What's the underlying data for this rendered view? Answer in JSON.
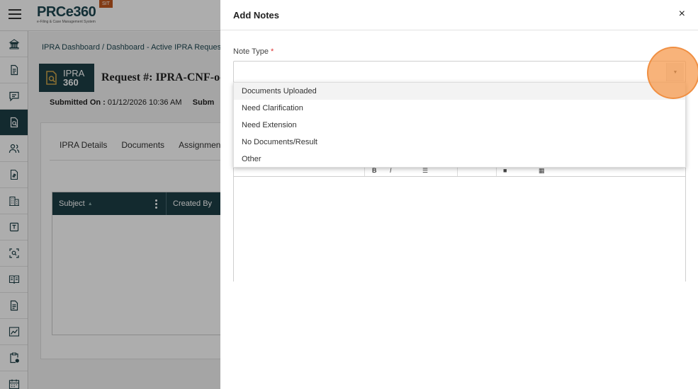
{
  "app": {
    "logo_text": "PRCe360",
    "logo_subtitle": "e-Filing & Case Management System",
    "env_badge": "SIT"
  },
  "breadcrumb": "IPRA Dashboard / Dashboard - Active IPRA Reques",
  "request": {
    "logo_line1": "IPRA",
    "logo_line2": "360",
    "title": "Request #: IPRA-CNF-oc",
    "submitted_label": "Submitted On :",
    "submitted_value": "01/12/2026 10:36 AM",
    "submitted_extra": "Subm"
  },
  "tabs": [
    "IPRA Details",
    "Documents",
    "Assignmen"
  ],
  "grid": {
    "columns": [
      "Subject",
      "Created By"
    ]
  },
  "sidebar_icons": [
    "bank-icon",
    "document-icon",
    "chat-icon",
    "document-search-icon",
    "users-icon",
    "invoice-icon",
    "building-icon",
    "template-icon",
    "scan-icon",
    "book-icon",
    "file-icon",
    "chart-icon",
    "clipboard-icon",
    "calendar-icon"
  ],
  "drawer": {
    "title": "Add Notes",
    "close": "×",
    "note_type_label": "Note Type",
    "required_mark": "*",
    "select_value": "",
    "arrow": "▼",
    "options": [
      "Documents Uploaded",
      "Need Clarification",
      "Need Extension",
      "No Documents/Result",
      "Other"
    ]
  },
  "colors": {
    "primary": "#1d3e46",
    "badge": "#c0571f",
    "click_highlight": "#f5964a"
  }
}
